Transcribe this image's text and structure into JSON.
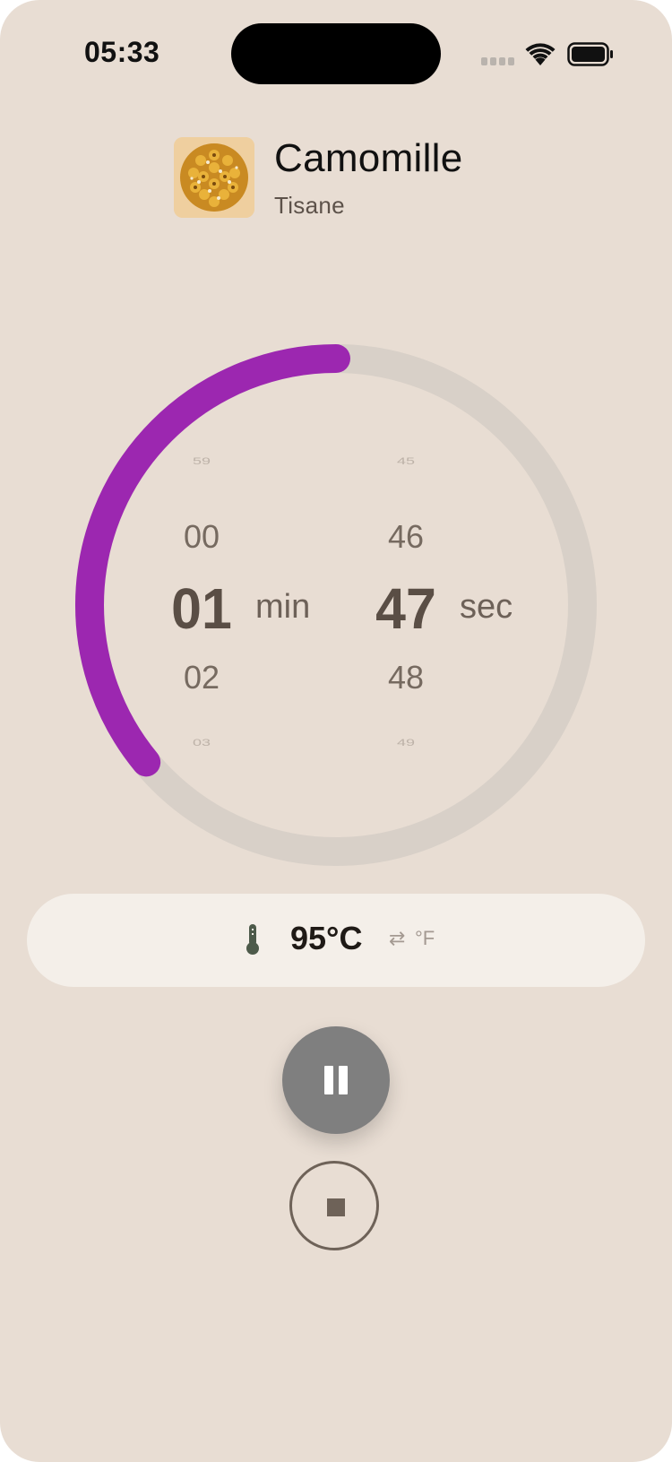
{
  "status_bar": {
    "time": "05:33",
    "icons": [
      "cellular-signal-icon",
      "wifi-icon",
      "battery-icon"
    ]
  },
  "tea": {
    "name": "Camomille",
    "type": "Tisane",
    "thumbnail": "chamomile-flowers"
  },
  "timer": {
    "progress_fraction": 0.36,
    "progress_color": "#9c27b0",
    "track_color": "#d8d0c8",
    "minutes": {
      "above_far": "59",
      "above": "00",
      "selected": "01",
      "below": "02",
      "below_far": "03",
      "unit": "min"
    },
    "seconds": {
      "above_far": "45",
      "above": "46",
      "selected": "47",
      "below": "48",
      "below_far": "49",
      "unit": "sec"
    }
  },
  "temperature": {
    "icon": "thermometer-icon",
    "value": "95°C",
    "swap_icon": "⇄",
    "alternate_unit": "°F"
  },
  "controls": {
    "pause_icon": "pause-icon",
    "stop_icon": "stop-icon"
  }
}
